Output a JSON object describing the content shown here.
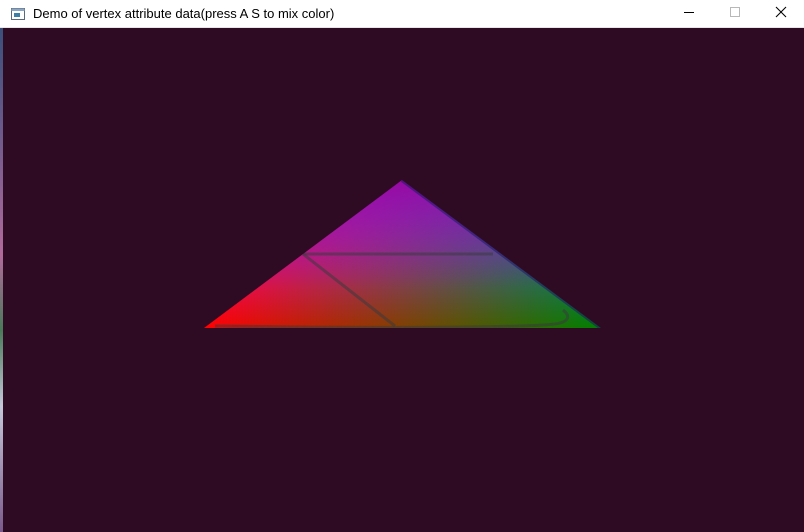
{
  "window": {
    "title": "Demo of vertex attribute data(press A S to mix color)",
    "icon": "app-window-icon",
    "controls": {
      "minimize_icon": "minimize-icon",
      "maximize_icon": "maximize-icon",
      "close_icon": "close-icon"
    }
  },
  "scene": {
    "clear_color": "#2e0b23",
    "vertex_colors": {
      "left": "#ff0000",
      "right": "#008000",
      "top": "#0000ff"
    }
  }
}
